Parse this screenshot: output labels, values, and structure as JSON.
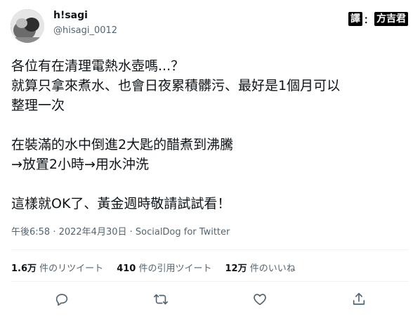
{
  "user": {
    "name": "h!sagi",
    "handle": "@hisagi_0012"
  },
  "badge": {
    "left": "譯",
    "sep": "：",
    "right": "方吉君"
  },
  "tweet": {
    "lines": [
      "各位有在清理電熱水壺嗎...？",
      "就算只拿來煮水、也會日夜累積髒污、最好是1個月可以",
      "整理一次",
      "",
      "在裝滿的水中倒進2大匙的醋煮到沸騰",
      "→放置2小時→用水沖洗",
      "",
      "這樣就OK了、黃金週時敬請試試看！"
    ]
  },
  "meta": "午後6:58 · 2022年4月30日 · SocialDog for Twitter",
  "stats": {
    "retweets": {
      "count": "1.6万",
      "label": "件のリツイート"
    },
    "quotes": {
      "count": "410",
      "label": "件の引用ツイート"
    },
    "likes": {
      "count": "12万",
      "label": "件のいいね"
    }
  },
  "icons": [
    "reply-icon",
    "retweet-icon",
    "like-icon",
    "share-icon"
  ],
  "colors": {
    "text": "#0f1419",
    "muted": "#536471",
    "divider": "#eff3f4"
  }
}
